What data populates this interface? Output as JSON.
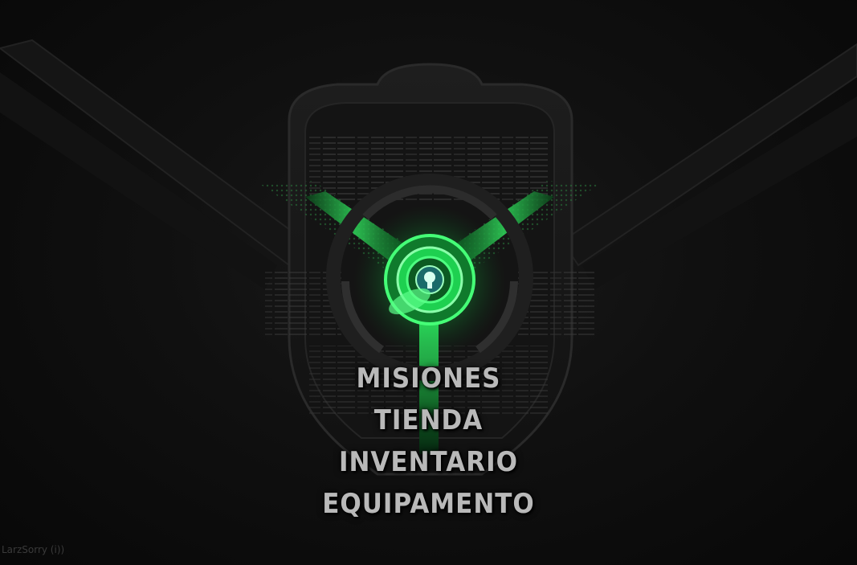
{
  "menu": {
    "items": [
      {
        "label": "MISIONES"
      },
      {
        "label": "TIENDA"
      },
      {
        "label": "INVENTARIO"
      },
      {
        "label": "EQUIPAMENTO"
      }
    ]
  },
  "credit": "LarzSorry (i))",
  "colors": {
    "background": "#0b0b0b",
    "accent_green": "#39ff6a",
    "menu_text": "#b9b9b9"
  },
  "icons": {
    "core": "glowing-green-reactor-icon"
  }
}
